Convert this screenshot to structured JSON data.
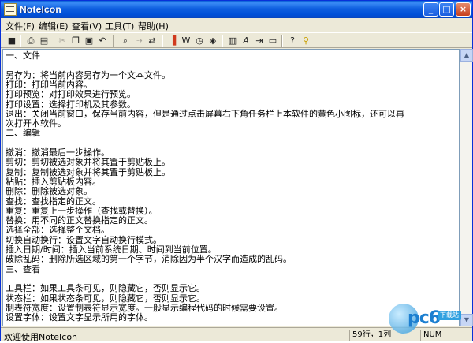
{
  "window": {
    "title": "NoteIcon",
    "controls": {
      "minimize": "_",
      "maximize": "□",
      "close": "×"
    }
  },
  "menubar": {
    "items": [
      "文件(F)",
      "编辑(E)",
      "查看(V)",
      "工具(T)",
      "帮助(H)"
    ]
  },
  "toolbar": {
    "icons": [
      "save-icon",
      "print-icon",
      "print-preview-icon",
      "new-icon",
      "open-icon",
      "undo-icon",
      "find-icon",
      "replace-icon",
      "cut-icon",
      "copy-icon",
      "paste-icon",
      "wrap-icon",
      "font-icon",
      "symbol-icon",
      "tab-width-icon",
      "text-color-icon",
      "special-char-icon",
      "window-icon",
      "help-icon",
      "pin-icon"
    ]
  },
  "editor": {
    "lines": [
      "一、文件",
      "",
      "另存为：将当前内容另存为一个文本文件。",
      "打印：打印当前内容。",
      "打印预览：对打印效果进行预览。",
      "打印设置：选择打印机及其参数。",
      "退出：关闭当前窗口，保存当前内容，但是通过点击屏幕右下角任务栏上本软件的黄色小图标，还可以再",
      "次打开本软件。",
      "二、编辑",
      "",
      "撤消：撤消最后一步操作。",
      "剪切：剪切被选对象并将其置于剪贴板上。",
      "复制：复制被选对象并将其置于剪贴板上。",
      "粘贴：插入剪贴板内容。",
      "删除：删除被选对象。",
      "查找：查找指定的正文。",
      "重复：重复上一步操作（查找或替换）。",
      "替换：用不同的正文替换指定的正文。",
      "选择全部：选择整个文档。",
      "切换自动换行：设置文字自动换行模式。",
      "插入日期/时间：插入当前系统日期、时间到当前位置。",
      "破除乱码：删除所选区域的第一个字节，消除因为半个汉字而造成的乱码。",
      "三、查看",
      "",
      "工具栏：如果工具条可见，则隐藏它，否则显示它。",
      "状态栏：如果状态条可见，则隐藏它，否则显示它。",
      "制表符宽度：设置制表符显示宽度。一般显示编程代码的时候需要设置。",
      "设置字体：设置文字显示所用的字体。"
    ]
  },
  "statusbar": {
    "message": "欢迎使用NoteIcon",
    "position": "59行，1列",
    "num": "NUM"
  },
  "watermark": {
    "text": "pc6",
    "tag": "下载站"
  },
  "colors": {
    "titlebar": "#0050d8",
    "chrome": "#ece9d8",
    "editor_bg": "#ffffff"
  }
}
